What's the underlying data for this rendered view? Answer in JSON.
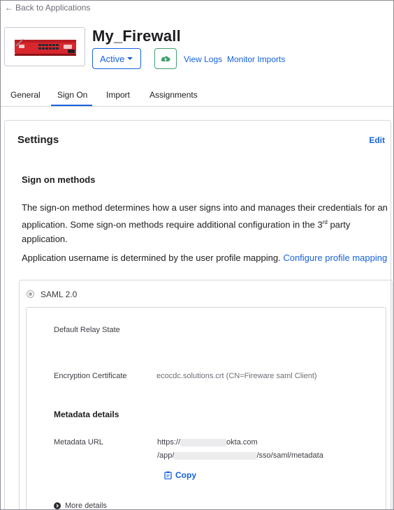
{
  "header": {
    "back_label": "Back to Applications",
    "app_title": "My_Firewall",
    "status": {
      "selected": "Active"
    },
    "links": {
      "view_logs": "View Logs",
      "monitor_imports": "Monitor Imports"
    }
  },
  "tabs": [
    {
      "label": "General"
    },
    {
      "label": "Sign On",
      "active": true
    },
    {
      "label": "Import"
    },
    {
      "label": "Assignments"
    }
  ],
  "settings": {
    "title": "Settings",
    "edit_label": "Edit",
    "methods_title": "Sign on methods",
    "description_part1": "The sign-on method determines how a user signs into and manages their credentials for an application. Some sign-on methods require additional configuration in the 3",
    "description_sup": "rd",
    "description_part2": " party application.",
    "username_text": "Application username is determined by the user profile mapping. ",
    "configure_link": "Configure profile mapping"
  },
  "saml": {
    "label": "SAML 2.0",
    "default_relay_label": "Default Relay State",
    "default_relay_value": "",
    "encryption_label": "Encryption Certificate",
    "encryption_value": "ecocdc.solutions.crt (CN=Fireware saml Client)",
    "metadata_title": "Metadata details",
    "metadata_url_label": "Metadata URL",
    "metadata_url_line1_prefix": "https://",
    "metadata_url_line1_suffix": "okta.com",
    "metadata_url_line2_prefix": "/app/",
    "metadata_url_line2_suffix": "/sso/saml/metadata",
    "copy_label": "Copy",
    "more_details_label": "More details"
  },
  "colors": {
    "link": "#1662dd",
    "green": "#3ea071",
    "logo_red": "#d7262c"
  },
  "icons": {
    "back": "arrow-left-icon",
    "edit_logo": "pencil-icon",
    "status_dropdown": "chevron-down-icon",
    "push": "cloud-push-icon",
    "copy": "clipboard-icon",
    "more_details": "chevron-right-circle-icon"
  }
}
